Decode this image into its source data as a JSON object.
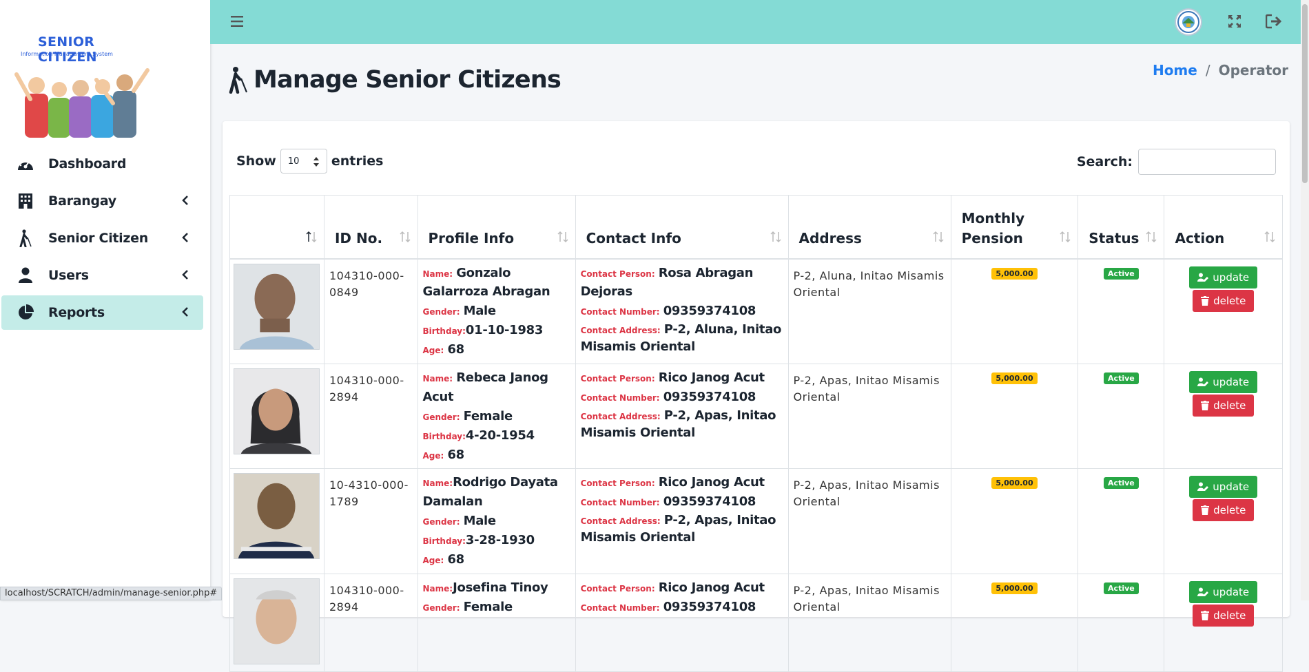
{
  "app": {
    "brand_title": "SENIOR CITIZEN",
    "brand_subtitle": "Information Management System"
  },
  "sidebar": {
    "items": [
      {
        "label": "Dashboard",
        "icon": "gauge-icon",
        "has_submenu": false
      },
      {
        "label": "Barangay",
        "icon": "building-icon",
        "has_submenu": true
      },
      {
        "label": "Senior Citizen",
        "icon": "walking-cane-icon",
        "has_submenu": true
      },
      {
        "label": "Users",
        "icon": "user-icon",
        "has_submenu": true
      },
      {
        "label": "Reports",
        "icon": "pie-chart-icon",
        "has_submenu": true,
        "active": true
      }
    ]
  },
  "topbar": {
    "icons": [
      "hamburger-icon",
      "municipal-seal",
      "expand-icon",
      "logout-icon"
    ]
  },
  "header": {
    "title": "Manage Senior Citizens",
    "breadcrumb": {
      "home": "Home",
      "separator": "/",
      "current": "Operator"
    }
  },
  "table_controls": {
    "show_label": "Show",
    "entries_value": "10",
    "entries_label": "entries",
    "search_label": "Search:",
    "search_value": ""
  },
  "table": {
    "columns": [
      "",
      "ID No.",
      "Profile Info",
      "Contact Info",
      "Address",
      "Monthly Pension",
      "Status",
      "Action"
    ],
    "labels": {
      "name": "Name:",
      "gender": "Gender:",
      "birthday": "Birthday:",
      "age": "Age:",
      "contact_person": "Contact Person:",
      "contact_number": "Contact Number:",
      "contact_address": "Contact Address:",
      "update": "update",
      "delete": "delete"
    },
    "rows": [
      {
        "id": "104310-000-0849",
        "name": "Gonzalo Galarroza Abragan",
        "gender": "Male",
        "birthday": "01-10-1983",
        "age": "68",
        "contact_person": "Rosa Abragan Dejoras",
        "contact_number": "09359374108",
        "contact_address": "P-2, Aluna, Initao Misamis Oriental",
        "address": "P-2, Aluna, Initao Misamis Oriental",
        "pension": "5,000.00",
        "status": "Active"
      },
      {
        "id": "104310-000-2894",
        "name": "Rebeca Janog Acut",
        "gender": "Female",
        "birthday": "4-20-1954",
        "age": "68",
        "contact_person": "Rico Janog Acut",
        "contact_number": "09359374108",
        "contact_address": "P-2, Apas, Initao Misamis Oriental",
        "address": "P-2, Apas, Initao Misamis Oriental",
        "pension": "5,000.00",
        "status": "Active"
      },
      {
        "id": "10-4310-000-1789",
        "name": "Rodrigo Dayata Damalan",
        "gender": "Male",
        "birthday": "3-28-1930",
        "age": "68",
        "contact_person": "Rico Janog Acut",
        "contact_number": "09359374108",
        "contact_address": "P-2, Apas, Initao Misamis Oriental",
        "address": "P-2, Apas, Initao Misamis Oriental",
        "pension": "5,000.00",
        "status": "Active"
      },
      {
        "id": "104310-000-2894",
        "name": "Josefina Tinoy",
        "gender": "Female",
        "birthday": "",
        "age": "",
        "contact_person": "Rico Janog Acut",
        "contact_number": "09359374108",
        "contact_address": "",
        "address": "P-2, Apas, Initao Misamis Oriental",
        "pension": "5,000.00",
        "status": "Active"
      }
    ]
  },
  "statusbar": {
    "url": "localhost/SCRATCH/admin/manage-senior.php#"
  },
  "colors": {
    "topbar": "#84dbd5",
    "active_nav": "#c4ece8",
    "label_red": "#dc3545",
    "success": "#28a745",
    "warning": "#ffc107",
    "link_blue": "#1e7cf0"
  }
}
